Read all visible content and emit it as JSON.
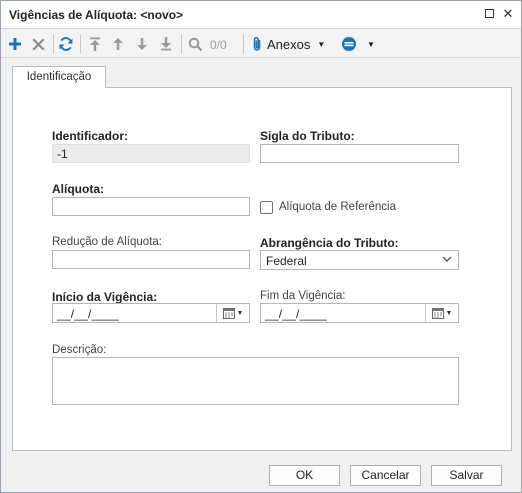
{
  "window": {
    "title": "Vigências de Alíquota: <novo>"
  },
  "toolbar": {
    "counter": "0/0",
    "anexos_label": "Anexos",
    "icons": [
      "add-icon",
      "delete-icon",
      "refresh-icon",
      "move-top-icon",
      "move-up-icon",
      "move-down-icon",
      "move-bottom-icon",
      "search-icon",
      "paperclip-icon",
      "options-icon"
    ],
    "accent_color": "#1a73b8"
  },
  "tabs": [
    {
      "label": "Identificação",
      "active": true
    }
  ],
  "form": {
    "identificador": {
      "label": "Identificador:",
      "value": "-1"
    },
    "sigla_tributo": {
      "label": "Sigla do Tributo:",
      "value": ""
    },
    "aliquota": {
      "label": "Alíquota:",
      "value": ""
    },
    "aliquota_referencia": {
      "label": "Alíquota de Referência",
      "checked": false
    },
    "reducao_aliquota": {
      "label": "Redução de Alíquota:",
      "value": ""
    },
    "abrangencia_tributo": {
      "label": "Abrangência do Tributo:",
      "value": "Federal"
    },
    "inicio_vigencia": {
      "label": "Início da Vigência:",
      "value": "__/__/____"
    },
    "fim_vigencia": {
      "label": "Fim da Vigência:",
      "value": "__/__/____"
    },
    "descricao": {
      "label": "Descrição:",
      "value": ""
    }
  },
  "footer": {
    "ok_label": "OK",
    "cancel_label": "Cancelar",
    "save_label": "Salvar"
  }
}
